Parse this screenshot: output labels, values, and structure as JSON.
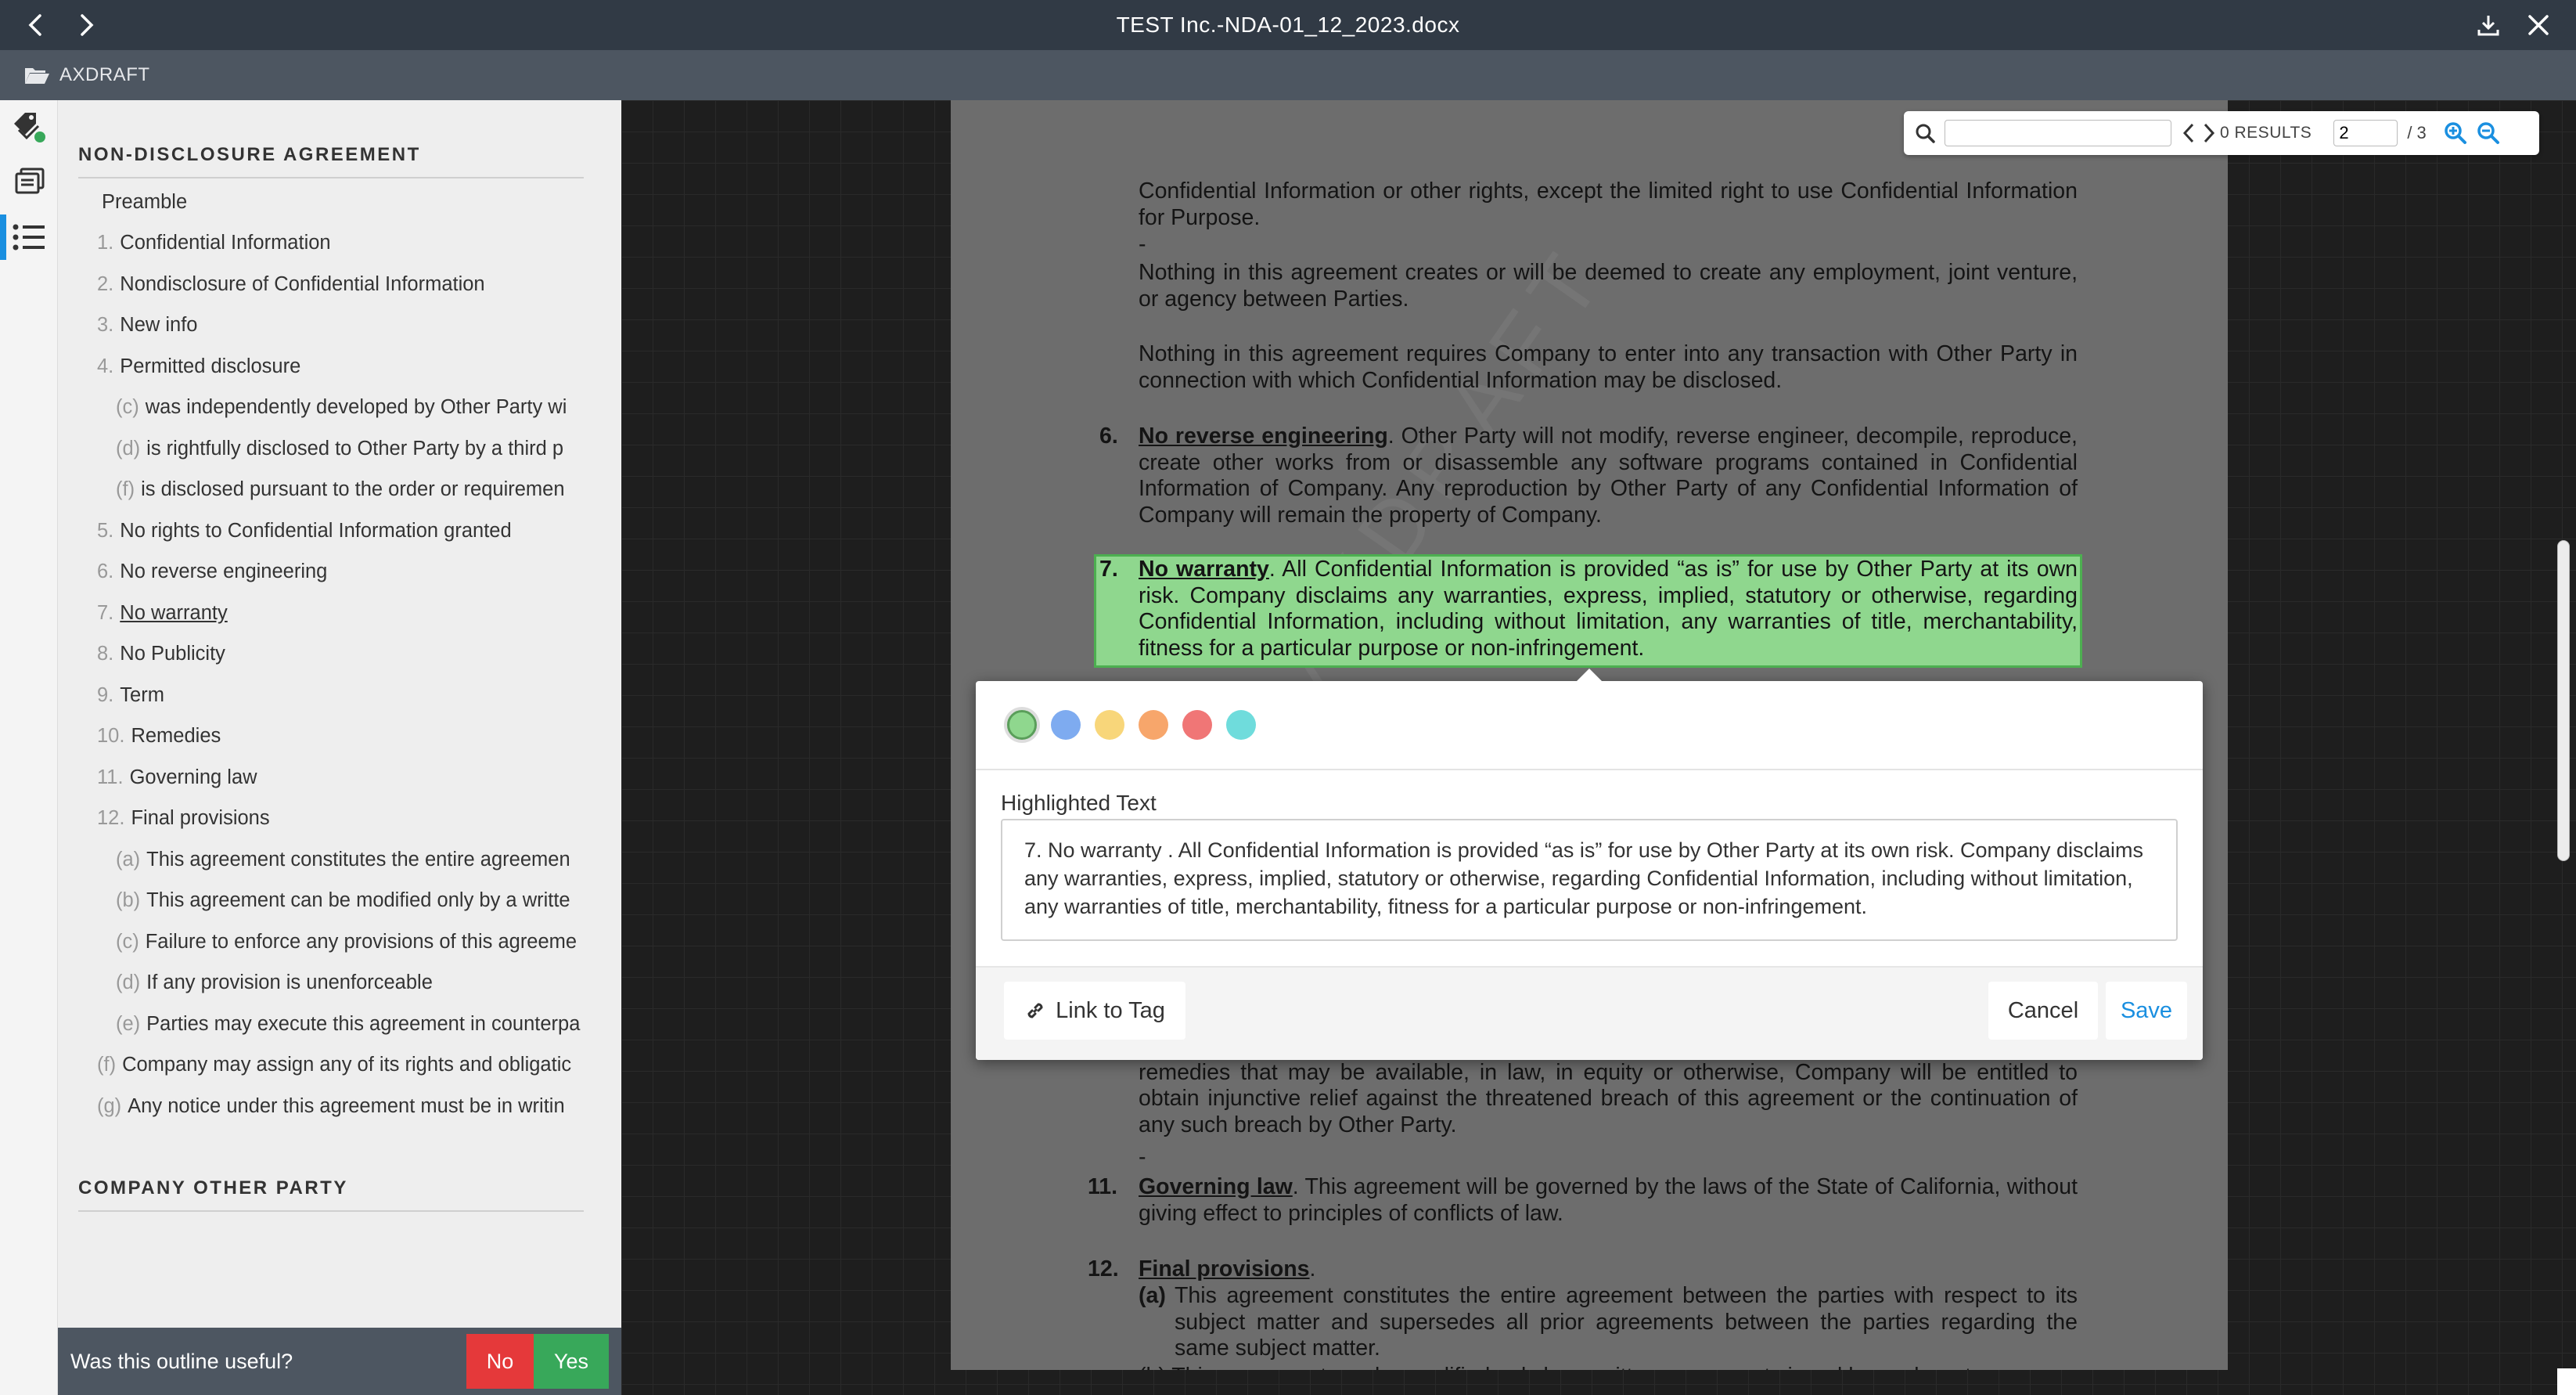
{
  "window": {
    "title": "TEST Inc.-NDA-01_12_2023.docx",
    "back_icon": "chevron-left-icon",
    "forward_icon": "chevron-right-icon",
    "download_icon": "download-icon",
    "close_icon": "close-icon"
  },
  "breadcrumb": {
    "folder_icon": "folder-open-icon",
    "label": "AXDRAFT"
  },
  "rail": [
    {
      "icon": "tags-icon",
      "active": false
    },
    {
      "icon": "layers-icon",
      "active": false
    },
    {
      "icon": "list-icon",
      "active": true
    }
  ],
  "outline": {
    "section_title": "NON-DISCLOSURE AGREEMENT",
    "items": [
      {
        "num": "",
        "label": "Preamble",
        "level": 0
      },
      {
        "num": "1.",
        "label": "Confidential Information",
        "level": 1
      },
      {
        "num": "2.",
        "label": "Nondisclosure of Confidential Information",
        "level": 1
      },
      {
        "num": "3.",
        "label": "New info",
        "level": 1
      },
      {
        "num": "4.",
        "label": "Permitted disclosure",
        "level": 1
      },
      {
        "num": "(c)",
        "label": "was independently developed by Other Party wi",
        "level": 2
      },
      {
        "num": "(d)",
        "label": "is rightfully disclosed to Other Party by a third p",
        "level": 2
      },
      {
        "num": "(f)",
        "label": "is disclosed pursuant to the order or requiremen",
        "level": 2
      },
      {
        "num": "5.",
        "label": "No rights to Confidential Information granted",
        "level": 1
      },
      {
        "num": "6.",
        "label": "No reverse engineering",
        "level": 1
      },
      {
        "num": "7.",
        "label": "No warranty",
        "level": 1,
        "underline": true
      },
      {
        "num": "8.",
        "label": "No Publicity",
        "level": 1
      },
      {
        "num": "9.",
        "label": "Term",
        "level": 1
      },
      {
        "num": "10.",
        "label": "Remedies",
        "level": 1
      },
      {
        "num": "11.",
        "label": "Governing law",
        "level": 1
      },
      {
        "num": "12.",
        "label": "Final provisions",
        "level": 1
      },
      {
        "num": "(a)",
        "label": "This agreement constitutes the entire agreemen",
        "level": 2
      },
      {
        "num": "(b)",
        "label": "This agreement can be modified only by a writte",
        "level": 2
      },
      {
        "num": "(c)",
        "label": "Failure to enforce any provisions of this agreeme",
        "level": 2
      },
      {
        "num": "(d)",
        "label": "If any provision is unenforceable",
        "level": 2
      },
      {
        "num": "(e)",
        "label": "Parties may execute this agreement in counterpa",
        "level": 2
      },
      {
        "num": "(f)",
        "label": "Company may assign any of its rights and obligatic",
        "level": 3
      },
      {
        "num": "(g)",
        "label": "Any notice under this agreement must be in writin",
        "level": 3
      }
    ],
    "section2_title": "COMPANY OTHER PARTY"
  },
  "feedback": {
    "question": "Was this outline useful?",
    "no": "No",
    "yes": "Yes"
  },
  "search": {
    "search_icon": "search-icon",
    "value": "",
    "results": "0 RESULTS",
    "page": "2",
    "total": "/ 3",
    "zoom_in_icon": "zoom-in-icon",
    "zoom_out_icon": "zoom-out-icon"
  },
  "document": {
    "p1": "Confidential Information or other rights, except the limited right to use Confidential Information for Purpose.",
    "dash1": "-",
    "p2": "Nothing in this agreement creates or will be deemed to create any employment, joint venture, or agency between Parties.",
    "p3": "Nothing in this agreement requires Company to enter into any transaction with Other Party in connection with which Confidential Information may be disclosed.",
    "s6_num": "6.",
    "s6_head": "No reverse engineering",
    "s6_body": ". Other Party will not modify, reverse engineer, decompile, reproduce, create other works from or disassemble any software programs contained in Confidential Information of Company. Any reproduction by Other Party of any Confidential Information of Company will remain the property of Company.",
    "s7_num": "7.",
    "s7_head": "No warranty",
    "s7_body": ". All Confidential Information is provided “as is” for use by Other Party at its own risk. Company disclaims any warranties, express, implied, statutory or otherwise, regarding Confidential Information, including without limitation, any warranties of title, merchantability, fitness for a particular purpose or non-infringement.",
    "s10_tail": "which monetary damages would be an inadequate remedy. Therefore, in addition to any other remedies that may be available, in law, in equity or otherwise, Company will be entitled to obtain injunctive relief against the threatened breach of this agreement or the continuation of any such breach by Other Party.",
    "dash2": "-",
    "s11_num": "11.",
    "s11_head": "Governing law",
    "s11_body": ". This agreement will be governed by the laws of the State of California, without giving effect to principles of conflicts of law.",
    "s12_num": "12.",
    "s12_head": "Final provisions",
    "s12_dot": ".",
    "s12a_num": "(a)",
    "s12a_body": "This agreement constitutes the entire agreement between the parties with respect to its subject matter and supersedes all prior agreements between the parties regarding the same subject matter.",
    "s12b_partial": "(b) This agreement can be modified only by a written agreement signed by each party."
  },
  "highlight_popup": {
    "colors": [
      {
        "name": "green",
        "hex": "#8fd78e",
        "selected": true
      },
      {
        "name": "blue",
        "hex": "#7eabf0"
      },
      {
        "name": "yellow",
        "hex": "#f8d67a"
      },
      {
        "name": "orange",
        "hex": "#f7a66b"
      },
      {
        "name": "red",
        "hex": "#f07676"
      },
      {
        "name": "cyan",
        "hex": "#6fdcdc"
      }
    ],
    "label": "Highlighted Text",
    "text": "7. No warranty . All Confidential Information is provided “as is” for use by Other Party at its own risk. Company disclaims any warranties, express, implied, statutory or otherwise, regarding Confidential Information, including without limitation, any warranties of title, merchantability, fitness for a particular purpose or non-infringement.",
    "link_icon": "link-icon",
    "link_label": "Link to Tag",
    "cancel_label": "Cancel",
    "save_label": "Save"
  },
  "colors": {
    "accent": "#1a8fe0",
    "titlebar": "#313a45",
    "breadbar": "#4d5661",
    "no": "#e5393a",
    "yes": "#38a85a"
  }
}
